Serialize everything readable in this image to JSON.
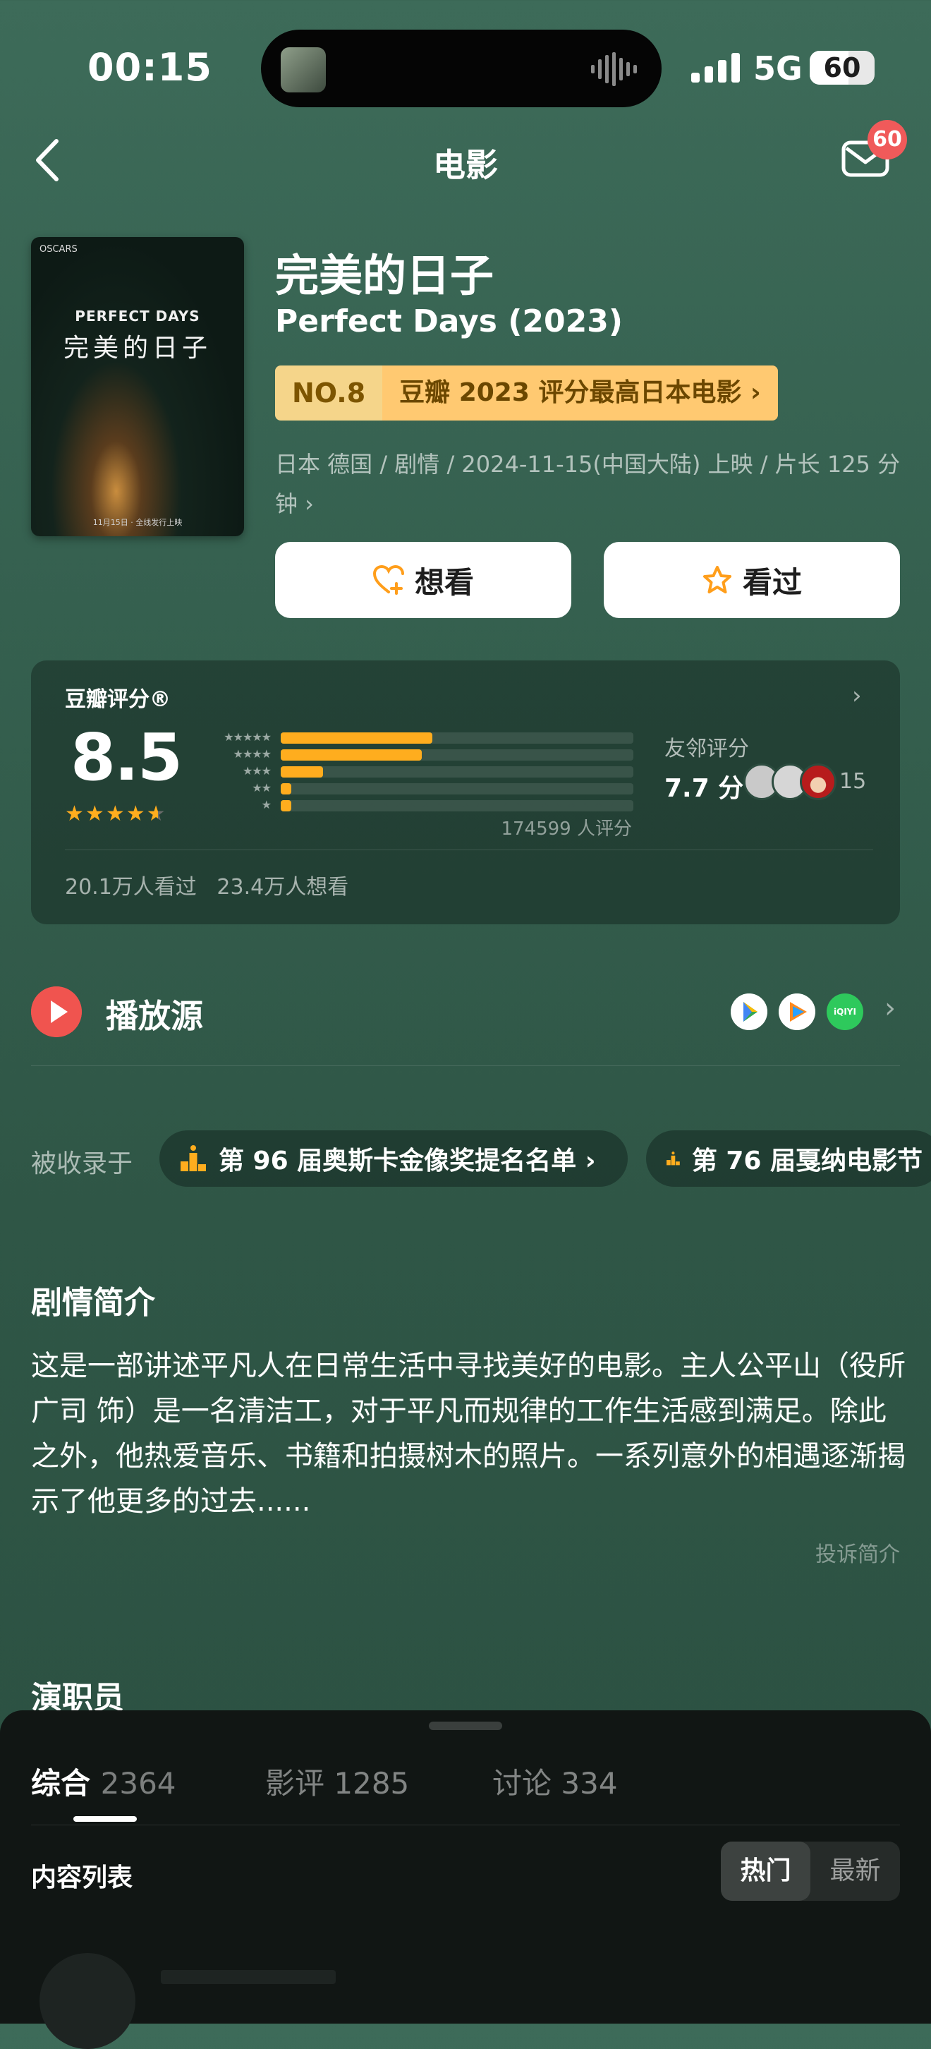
{
  "status_bar": {
    "time": "00:15",
    "network": "5G",
    "battery": "60",
    "battery_level": 0.6
  },
  "nav": {
    "title": "电影",
    "mail_badge": "60"
  },
  "movie": {
    "title_cn": "完美的日子",
    "title_en": "Perfect Days (2023)",
    "rank_no": "NO.8",
    "rank_text": "豆瓣 2023 评分最高日本电影 ›",
    "meta": "日本 德国 / 剧情 / 2024-11-15(中国大陆) 上映 / 片长 125 分钟 ›",
    "poster": {
      "top_text": "OSCARS",
      "en": "PERFECT DAYS",
      "cn": "完美的日子",
      "bottom": "11月15日 · 全线发行上映"
    }
  },
  "actions": {
    "want": "想看",
    "seen": "看过"
  },
  "rating": {
    "label": "豆瓣评分®",
    "score": "8.5",
    "stars": 4.5,
    "distribution": [
      0.43,
      0.4,
      0.12,
      0.03,
      0.03
    ],
    "count": "174599 人评分",
    "friends_label": "友邻评分",
    "friends_score": "7.7 分",
    "friends_count": "15",
    "seen_stats": "20.1万人看过   23.4万人想看"
  },
  "play_source": {
    "label": "播放源",
    "sources": [
      "google-play-icon",
      "tencent-video-icon",
      "iqiyi-icon"
    ],
    "iqiyi_text": "iQIYI"
  },
  "collected": {
    "label": "被收录于",
    "lists": [
      "第 96 届奥斯卡金像奖提名名单 ›",
      "第 76 届戛纳电影节"
    ]
  },
  "synopsis": {
    "title": "剧情简介",
    "text": "这是一部讲述平凡人在日常生活中寻找美好的电影。主人公平山（役所广司 饰）是一名清洁工，对于平凡而规律的工作生活感到满足。除此之外，他热爱音乐、书籍和拍摄树木的照片。一系列意外的相遇逐渐揭示了他更多的过去......",
    "report": "投诉简介"
  },
  "cast": {
    "title": "演职员"
  },
  "sheet": {
    "tabs": [
      {
        "label": "综合",
        "count": "2364"
      },
      {
        "label": "影评",
        "count": "1285"
      },
      {
        "label": "讨论",
        "count": "334"
      }
    ],
    "list_title": "内容列表",
    "sort": [
      "热门",
      "最新"
    ]
  },
  "colors": {
    "accent": "#ffad1e",
    "play": "#f0544f",
    "rank_bg": "#ffc971"
  }
}
